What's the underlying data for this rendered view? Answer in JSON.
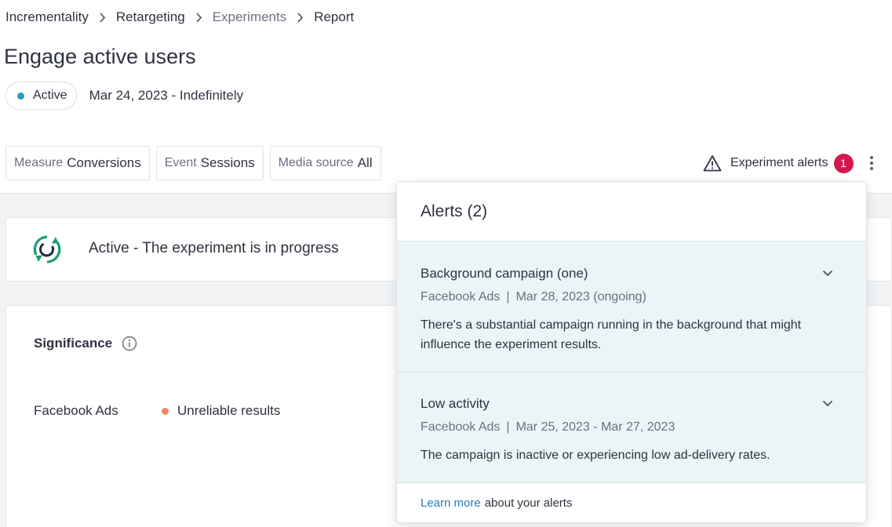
{
  "breadcrumb": [
    "Incrementality",
    "Retargeting",
    "Experiments",
    "Report"
  ],
  "title": "Engage active users",
  "status": {
    "label": "Active",
    "dot_color": "#2b98c4",
    "date_range": "Mar 24, 2023 - Indefinitely"
  },
  "filters": [
    {
      "key": "Measure",
      "value": "Conversions"
    },
    {
      "key": "Event",
      "value": "Sessions"
    },
    {
      "key": "Media source",
      "value": "All"
    }
  ],
  "alerts_trigger": {
    "label": "Experiment alerts",
    "count": "1",
    "icon": "warning-triangle-icon",
    "badge_color": "#d4184f"
  },
  "experiment_status": {
    "state": "Active -",
    "text": "The experiment is in progress",
    "icon": "sync-icon"
  },
  "significance": {
    "title": "Significance",
    "rows": [
      {
        "source": "Facebook Ads",
        "result": "Unreliable results",
        "dot_color": "#f0866a"
      }
    ]
  },
  "alerts_panel": {
    "title": "Alerts (2)",
    "items": [
      {
        "title": "Background campaign (one)",
        "source": "Facebook Ads",
        "date": "Mar 28, 2023 (ongoing)",
        "description": "There's a substantial campaign running in the background that might influence the experiment results."
      },
      {
        "title": "Low activity",
        "source": "Facebook Ads",
        "date": "Mar 25, 2023 - Mar 27, 2023",
        "description": "The campaign is inactive or experiencing low ad-delivery rates."
      }
    ],
    "footer_link": "Learn more",
    "footer_text": "about your alerts"
  }
}
